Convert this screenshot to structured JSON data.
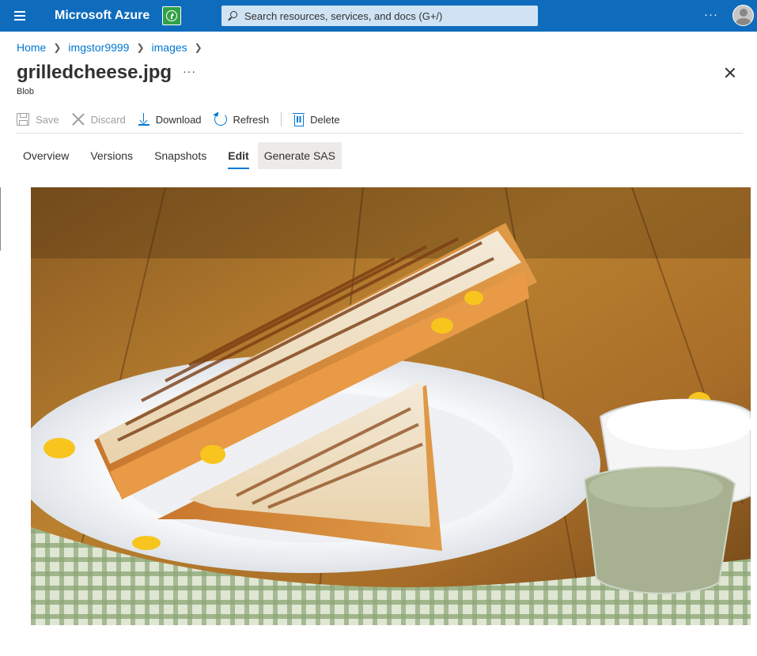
{
  "topbar": {
    "brand": "Microsoft Azure",
    "search_placeholder": "Search resources, services, and docs (G+/)",
    "more": "···"
  },
  "breadcrumb": {
    "items": [
      "Home",
      "imgstor9999",
      "images"
    ]
  },
  "blade": {
    "title": "grilledcheese.jpg",
    "title_more": "···",
    "subtitle": "Blob"
  },
  "toolbar": {
    "save": "Save",
    "discard": "Discard",
    "download": "Download",
    "refresh": "Refresh",
    "delete": "Delete"
  },
  "tabs": [
    {
      "label": "Overview"
    },
    {
      "label": "Versions"
    },
    {
      "label": "Snapshots"
    },
    {
      "label": "Edit",
      "active": true
    },
    {
      "label": "Generate SAS"
    }
  ],
  "colors": {
    "topbar": "#0f6cbd",
    "accent": "#0078d4"
  },
  "icons": [
    "hamburger-icon",
    "upgrade-icon",
    "search-icon",
    "more-icon",
    "avatar",
    "close-icon",
    "save-icon",
    "discard-icon",
    "download-icon",
    "refresh-icon",
    "delete-icon"
  ]
}
